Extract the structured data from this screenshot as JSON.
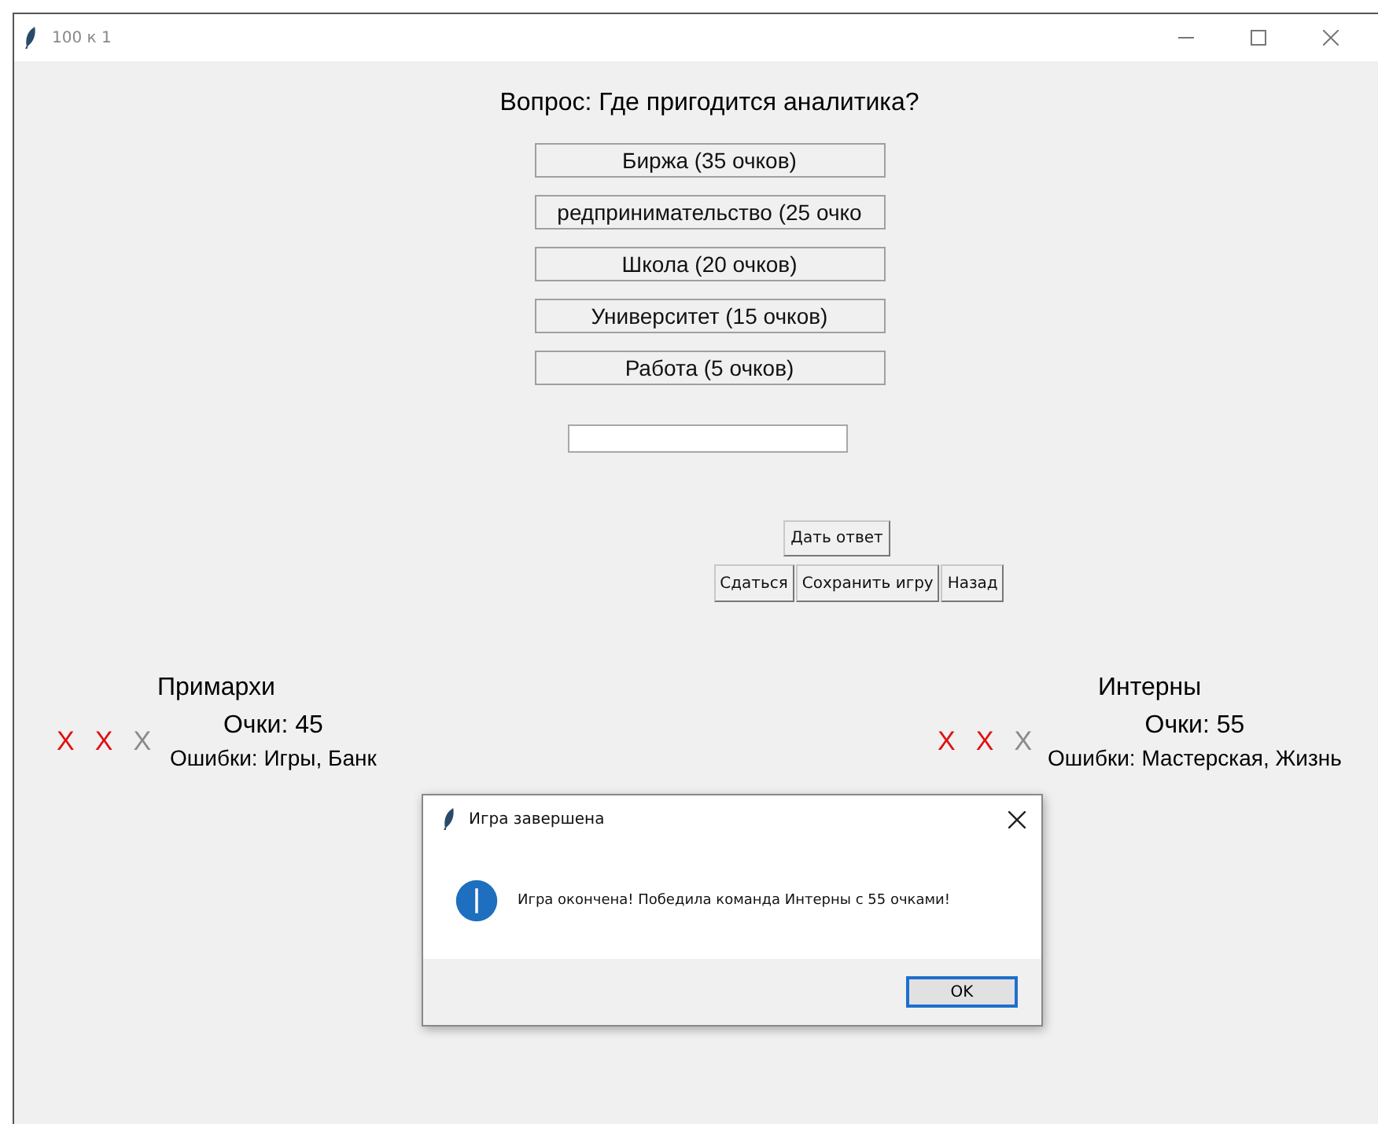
{
  "window": {
    "title": "100 к 1"
  },
  "question": "Вопрос: Где пригодится аналитика?",
  "answers": [
    {
      "label": "Биржа (35 очков)"
    },
    {
      "label": "редпринимательство (25 очко"
    },
    {
      "label": "Школа (20 очков)"
    },
    {
      "label": "Университет (15 очков)"
    },
    {
      "label": "Работа (5 очков)"
    }
  ],
  "submit_button": "Дать ответ",
  "actions": [
    "Сдаться",
    "Сохранить игру",
    "Назад"
  ],
  "teams": [
    {
      "name": "Примархи",
      "score": "Очки: 45",
      "errors": "Ошибки: Игры, Банк",
      "strikes": [
        {
          "label": "X",
          "on": true
        },
        {
          "label": "X",
          "on": true
        },
        {
          "label": "X",
          "on": false
        }
      ]
    },
    {
      "name": "Интерны",
      "score": "Очки: 55",
      "errors": "Ошибки: Мастерская, Жизнь",
      "strikes": [
        {
          "label": "X",
          "on": true
        },
        {
          "label": "X",
          "on": true
        },
        {
          "label": "X",
          "on": false
        }
      ]
    }
  ],
  "dialog": {
    "title": "Игра завершена",
    "message": "Игра окончена! Победила команда Интерны с 55 очками!",
    "button": "OK"
  }
}
